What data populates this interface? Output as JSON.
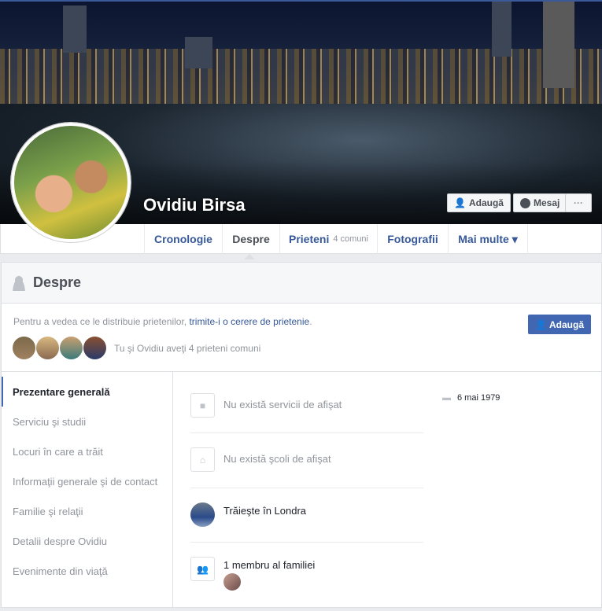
{
  "profile": {
    "name": "Ovidiu Birsa"
  },
  "cover_buttons": {
    "add": "Adaugă",
    "message": "Mesaj",
    "more": "···"
  },
  "tabs": [
    {
      "label": "Cronologie"
    },
    {
      "label": "Despre"
    },
    {
      "label": "Prieteni",
      "sub": "4 comuni"
    },
    {
      "label": "Fotografii"
    },
    {
      "label": "Mai multe ▾"
    }
  ],
  "about": {
    "title": "Despre",
    "intro_text": "Pentru a vedea ce le distribuie prietenilor, ",
    "intro_link": "trimite-i o cerere de prietenie",
    "intro_end": ".",
    "mutual": "Tu şi Ovidiu aveţi 4 prieteni comuni",
    "add_button": "Adaugă"
  },
  "sidebar": [
    {
      "label": "Prezentare generală"
    },
    {
      "label": "Serviciu şi studii"
    },
    {
      "label": "Locuri în care a trăit"
    },
    {
      "label": "Informaţii generale şi de contact"
    },
    {
      "label": "Familie şi relaţii"
    },
    {
      "label": "Detalii despre Ovidiu"
    },
    {
      "label": "Evenimente din viaţă"
    }
  ],
  "overview": {
    "work": "Nu există servicii de afişat",
    "school": "Nu există şcoli de afişat",
    "lives": "Trăieşte în Londra",
    "family": "1 membru al familiei",
    "birthday": "6 mai 1979"
  }
}
